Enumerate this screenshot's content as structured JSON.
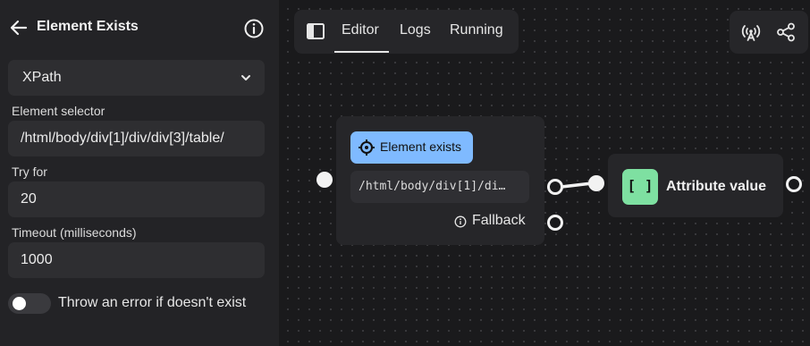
{
  "panel": {
    "title": "Element Exists",
    "select_value": "XPath",
    "fields": [
      {
        "label": "Element selector",
        "value": "/html/body/div[1]/div/div[3]/table/"
      },
      {
        "label": "Try for",
        "value": "20"
      },
      {
        "label": "Timeout (milliseconds)",
        "value": "1000"
      }
    ],
    "toggle_label": "Throw an error if doesn't exist",
    "toggle_on": false
  },
  "canvas": {
    "tabs": [
      {
        "label": "Editor",
        "active": true
      },
      {
        "label": "Logs",
        "active": false
      },
      {
        "label": "Running",
        "active": false
      }
    ],
    "nodes": {
      "element_exists": {
        "badge": "Element exists",
        "selector_preview": "/html/body/div[1]/di…",
        "fallback_label": "Fallback",
        "badge_color": "#7fbaff"
      },
      "attribute_value": {
        "tag": "[ ]",
        "title": "Attribute value",
        "tag_color": "#7ee0a1"
      }
    },
    "icons": [
      "sidebar-toggle-icon",
      "broadcast-icon",
      "share-icon"
    ]
  }
}
